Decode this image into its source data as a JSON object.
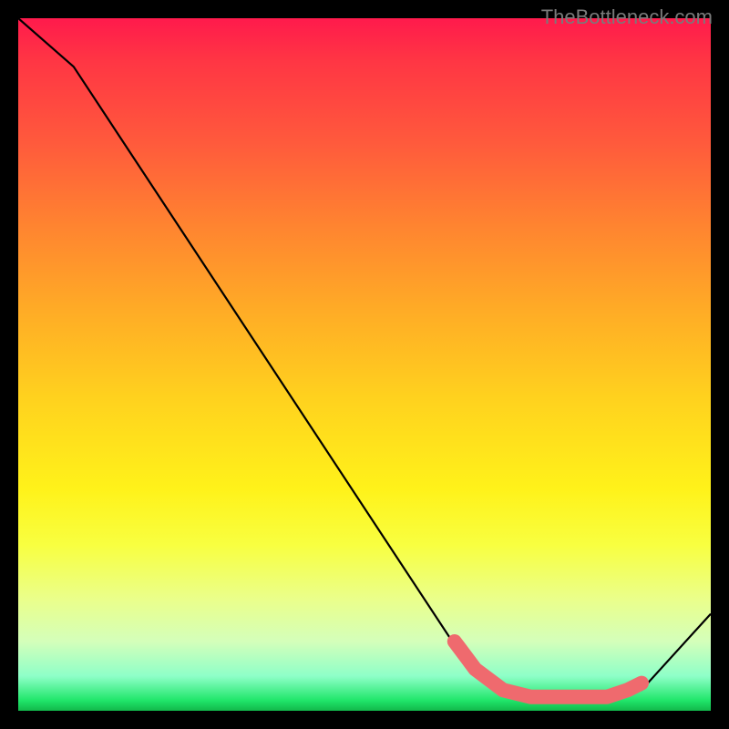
{
  "watermark": "TheBottleneck.com",
  "chart_data": {
    "type": "line",
    "title": "",
    "xlabel": "",
    "ylabel": "",
    "xlim": [
      0,
      100
    ],
    "ylim": [
      0,
      100
    ],
    "series": [
      {
        "name": "curve",
        "x": [
          0,
          8,
          64,
          72,
          86,
          90,
          100
        ],
        "values": [
          100,
          93,
          8,
          2,
          2,
          3,
          14
        ]
      }
    ],
    "highlight_band": {
      "name": "optimal-zone",
      "x": [
        63,
        66,
        70,
        74,
        78,
        82,
        85,
        88,
        90
      ],
      "values": [
        10,
        6,
        3,
        2,
        2,
        2,
        2,
        3,
        4
      ],
      "color": "#ef6a6e"
    },
    "gradient_stops": [
      {
        "pos": 0.0,
        "color": "#ff1a4c"
      },
      {
        "pos": 0.5,
        "color": "#ffd21e"
      },
      {
        "pos": 0.8,
        "color": "#f8ff40"
      },
      {
        "pos": 0.98,
        "color": "#20e66a"
      },
      {
        "pos": 1.0,
        "color": "#12b84a"
      }
    ]
  }
}
